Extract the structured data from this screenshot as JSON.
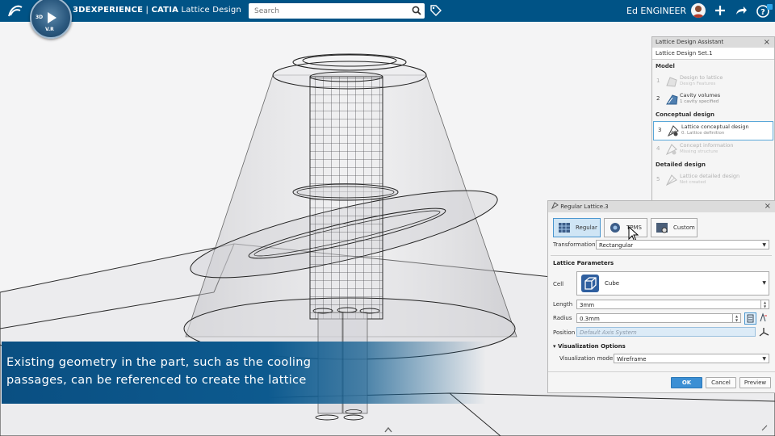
{
  "app": {
    "brand_bold": "3DEXPERIENCE",
    "brand_sep": " | ",
    "brand_app": "CATIA",
    "brand_module": " Lattice Design",
    "compass_labels": [
      "3D",
      "V.R"
    ]
  },
  "search": {
    "placeholder": "Search"
  },
  "user": {
    "name": "Ed ENGINEER"
  },
  "assistant": {
    "title": "Lattice Design Assistant",
    "set_name": "Lattice Design Set.1",
    "sections": [
      {
        "title": "Model",
        "steps": [
          {
            "num": "1",
            "title": "Design to lattice",
            "status": "Design Features"
          },
          {
            "num": "2",
            "title": "Cavity volumes",
            "status": "1 cavity specified"
          }
        ]
      },
      {
        "title": "Conceptual design",
        "steps": [
          {
            "num": "3",
            "title": "Lattice conceptual design",
            "status": "0. Lattice definition"
          },
          {
            "num": "4",
            "title": "Concept information",
            "status": "Missing structure"
          }
        ]
      },
      {
        "title": "Detailed design",
        "steps": [
          {
            "num": "5",
            "title": "Lattice detailed design",
            "status": "Not created"
          }
        ]
      }
    ]
  },
  "lattice_dialog": {
    "title": "Regular Lattice.3",
    "types": [
      "Regular",
      "TPMS",
      "Custom"
    ],
    "selected_type": "Regular",
    "transformation_label": "Transformation",
    "transformation_value": "Rectangular",
    "params_header": "Lattice Parameters",
    "cell_label": "Cell",
    "cell_value": "Cube",
    "length_label": "Length",
    "length_value": "3mm",
    "radius_label": "Radius",
    "radius_value": "0.3mm",
    "position_label": "Position",
    "position_placeholder": "Default Axis System",
    "vis_header": "Visualization Options",
    "vis_mode_label": "Visualization mode",
    "vis_mode_value": "Wireframe",
    "ok": "OK",
    "cancel": "Cancel",
    "preview": "Preview"
  },
  "caption": {
    "line1": "Existing geometry in the part, such as the cooling",
    "line2": "passages, can be referenced to create the lattice"
  },
  "colors": {
    "topbar": "#005386",
    "caption": "#0a4f82",
    "ok_button": "#3c8fd4",
    "selected_type": "#cfe5f5"
  }
}
